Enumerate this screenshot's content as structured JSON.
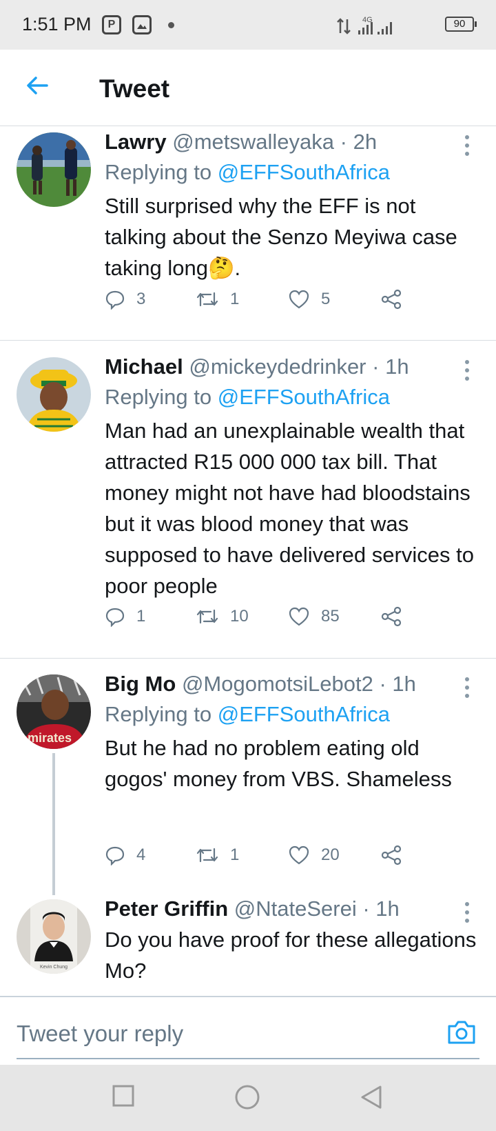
{
  "status_bar": {
    "time": "1:51 PM",
    "app_icon_1": "P",
    "network": "4G",
    "battery": "90"
  },
  "header": {
    "title": "Tweet",
    "back_icon": "arrow-left-icon"
  },
  "tweets": [
    {
      "name": "Lawry",
      "handle": "@metswalleyaka",
      "time": "· 2h",
      "replying_label": "Replying to",
      "replying_to": "@EFFSouthAfrica",
      "text": "Still surprised why the EFF is not talking about the Senzo Meyiwa case taking long🤔.",
      "replies": "3",
      "retweets": "1",
      "likes": "5"
    },
    {
      "name": "Michael",
      "handle": "@mickeydedrinker",
      "time": "· 1h",
      "replying_label": "Replying to",
      "replying_to": "@EFFSouthAfrica",
      "text": "Man had an unexplainable wealth that attracted R15 000 000 tax bill. That money might not have had bloodstains but it was blood money that was supposed to have delivered services to poor people",
      "replies": "1",
      "retweets": "10",
      "likes": "85"
    },
    {
      "name": "Big Mo",
      "handle": "@MogomotsiLebot2",
      "time": "· 1h",
      "replying_label": "Replying to",
      "replying_to": "@EFFSouthAfrica",
      "text": "But he had no problem eating old gogos' money from VBS. Shameless",
      "replies": "4",
      "retweets": "1",
      "likes": "20",
      "avatar_text": "mirates"
    },
    {
      "name": "Peter Griffin",
      "handle": "@NtateSerei",
      "time": "· 1h",
      "text": "Do you have proof for these allegations Mo?",
      "avatar_caption": "Kevin Chung"
    }
  ],
  "reply_bar": {
    "placeholder": "Tweet your reply"
  },
  "colors": {
    "accent": "#1da1f2",
    "secondary_text": "#657786",
    "primary_text": "#14171a"
  }
}
